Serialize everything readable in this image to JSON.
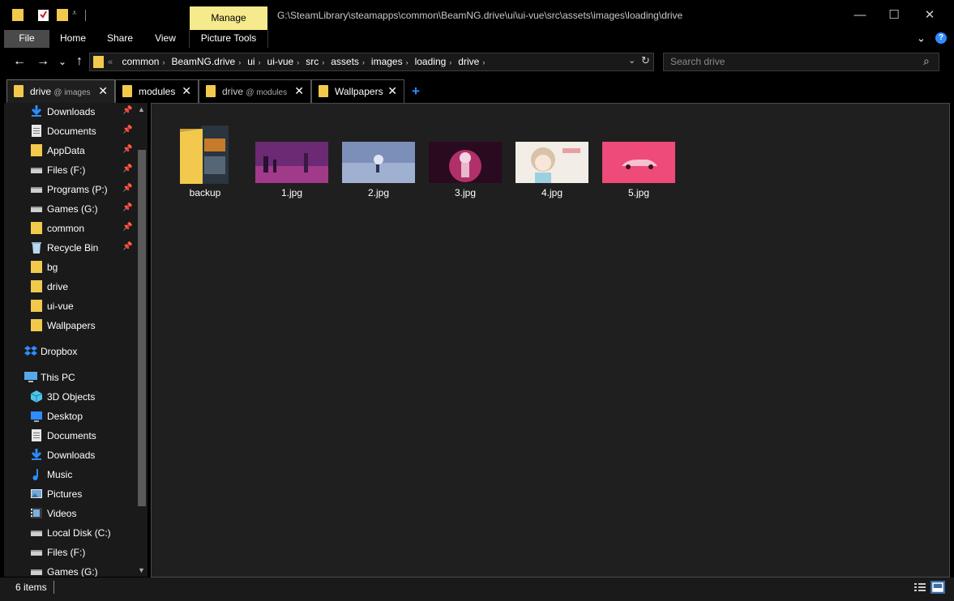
{
  "titlebar": {
    "manage_label": "Manage",
    "path": "G:\\SteamLibrary\\steamapps\\common\\BeamNG.drive\\ui\\ui-vue\\src\\assets\\images\\loading\\drive",
    "minimize": "—",
    "maximize": "☐",
    "close": "✕"
  },
  "ribbon": {
    "file": "File",
    "home": "Home",
    "share": "Share",
    "view": "View",
    "picture_tools": "Picture Tools",
    "expand_icon": "⌃",
    "help_icon": "?"
  },
  "nav": {
    "back": "←",
    "forward": "→",
    "recent": "⌄",
    "up": "↑",
    "overflow": "«",
    "breadcrumbs": [
      "common",
      "BeamNG.drive",
      "ui",
      "ui-vue",
      "src",
      "assets",
      "images",
      "loading",
      "drive"
    ],
    "crumb_sep": "›",
    "dropdown": "⌄",
    "refresh": "↻",
    "search_placeholder": "Search drive",
    "search_icon": "⌕"
  },
  "tabs": [
    {
      "title": "drive",
      "sub": "@ images",
      "close": "✕"
    },
    {
      "title": "modules",
      "sub": "",
      "close": "✕"
    },
    {
      "title": "drive",
      "sub": "@ modules",
      "close": "✕"
    },
    {
      "title": "Wallpapers",
      "sub": "",
      "close": "✕"
    }
  ],
  "newtab": "+",
  "sidebar": {
    "quick_access": [
      "Downloads",
      "Documents",
      "AppData",
      "Files (F:)",
      "Programs (P:)",
      "Games (G:)",
      "common",
      "Recycle Bin",
      "bg",
      "drive",
      "ui-vue",
      "Wallpapers"
    ],
    "pin": "📌",
    "dropbox": "Dropbox",
    "this_pc": "This PC",
    "pc_items": [
      "3D Objects",
      "Desktop",
      "Documents",
      "Downloads",
      "Music",
      "Pictures",
      "Videos",
      "Local Disk (C:)",
      "Files (F:)",
      "Games (G:)"
    ],
    "scroll_up": "▲",
    "scroll_down": "▼"
  },
  "files": [
    {
      "name": "backup",
      "type": "folder"
    },
    {
      "name": "1.jpg",
      "type": "image",
      "color": "#6b2a73"
    },
    {
      "name": "2.jpg",
      "type": "image",
      "color": "#7c8fb8"
    },
    {
      "name": "3.jpg",
      "type": "image",
      "color": "#b0306a"
    },
    {
      "name": "4.jpg",
      "type": "image",
      "color": "#f2ede6"
    },
    {
      "name": "5.jpg",
      "type": "image",
      "color": "#ee4a7a"
    }
  ],
  "status": {
    "count": "6 items"
  },
  "colors": {
    "accent": "#2f8cff",
    "folder": "#f2c94c",
    "manage": "#f5ea8c"
  }
}
